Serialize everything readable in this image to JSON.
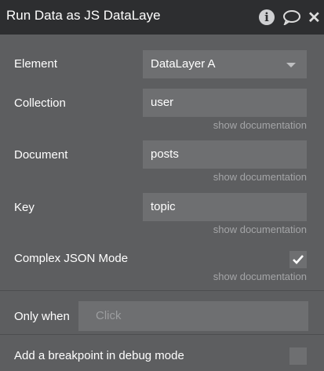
{
  "header": {
    "title": "Run Data as JS DataLaye",
    "info_icon": "info-icon",
    "comment_icon": "comment-icon",
    "close_icon": "close-icon"
  },
  "fields": {
    "element": {
      "label": "Element",
      "value": "DataLayer A"
    },
    "collection": {
      "label": "Collection",
      "value": "user",
      "doc": "show documentation"
    },
    "document": {
      "label": "Document",
      "value": "posts",
      "doc": "show documentation"
    },
    "key": {
      "label": "Key",
      "value": "topic",
      "doc": "show documentation"
    },
    "complex_json": {
      "label": "Complex JSON Mode",
      "checked": true,
      "doc": "show documentation"
    }
  },
  "only_when": {
    "label": "Only when",
    "placeholder": "Click"
  },
  "breakpoint": {
    "label": "Add a breakpoint in debug mode",
    "checked": false
  },
  "colors": {
    "header_bg": "#2d2e30",
    "panel_bg": "#5d5e60",
    "field_bg": "#6e6f71",
    "doc_text": "#a4a5a7"
  }
}
